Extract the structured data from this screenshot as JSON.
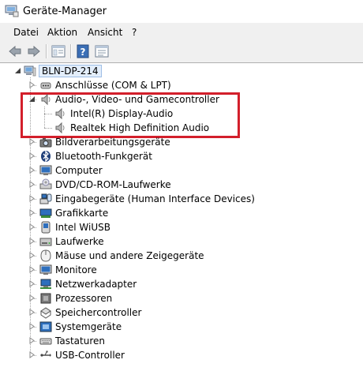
{
  "window": {
    "title": "Geräte-Manager"
  },
  "menu": {
    "items": [
      "Datei",
      "Aktion",
      "Ansicht",
      "?"
    ]
  },
  "toolbar": {
    "buttons": [
      "back-arrow-icon",
      "forward-arrow-icon",
      "show-hide-tree-icon",
      "help-icon",
      "properties-icon"
    ]
  },
  "tree": {
    "root": {
      "label": "BLN-DP-214",
      "icon": "computer-icon",
      "expanded": true
    },
    "items": [
      {
        "label": "Anschlüsse (COM & LPT)",
        "icon": "port-icon",
        "expanded": false
      },
      {
        "label": "Audio-, Video- und Gamecontroller",
        "icon": "speaker-icon",
        "expanded": true,
        "children": [
          {
            "label": "Intel(R) Display-Audio",
            "icon": "speaker-icon"
          },
          {
            "label": "Realtek High Definition Audio",
            "icon": "speaker-icon"
          }
        ]
      },
      {
        "label": "Bildverarbeitungsgeräte",
        "icon": "camera-icon",
        "expanded": false
      },
      {
        "label": "Bluetooth-Funkgerät",
        "icon": "bluetooth-icon",
        "expanded": false
      },
      {
        "label": "Computer",
        "icon": "monitor-icon",
        "expanded": false
      },
      {
        "label": "DVD/CD-ROM-Laufwerke",
        "icon": "optical-drive-icon",
        "expanded": false
      },
      {
        "label": "Eingabegeräte (Human Interface Devices)",
        "icon": "hid-icon",
        "expanded": false
      },
      {
        "label": "Grafikkarte",
        "icon": "display-adapter-icon",
        "expanded": false
      },
      {
        "label": "Intel WiUSB",
        "icon": "usb-device-icon",
        "expanded": false
      },
      {
        "label": "Laufwerke",
        "icon": "disk-drive-icon",
        "expanded": false
      },
      {
        "label": "Mäuse und andere Zeigegeräte",
        "icon": "mouse-icon",
        "expanded": false
      },
      {
        "label": "Monitore",
        "icon": "monitor-icon",
        "expanded": false
      },
      {
        "label": "Netzwerkadapter",
        "icon": "network-adapter-icon",
        "expanded": false
      },
      {
        "label": "Prozessoren",
        "icon": "processor-icon",
        "expanded": false
      },
      {
        "label": "Speichercontroller",
        "icon": "storage-controller-icon",
        "expanded": false
      },
      {
        "label": "Systemgeräte",
        "icon": "system-device-icon",
        "expanded": false
      },
      {
        "label": "Tastaturen",
        "icon": "keyboard-icon",
        "expanded": false
      },
      {
        "label": "USB-Controller",
        "icon": "usb-controller-icon",
        "expanded": false
      }
    ]
  },
  "colors": {
    "highlight": "#d31f2b",
    "menubar": "#f0f0f0",
    "selection": "#e3eefb"
  }
}
